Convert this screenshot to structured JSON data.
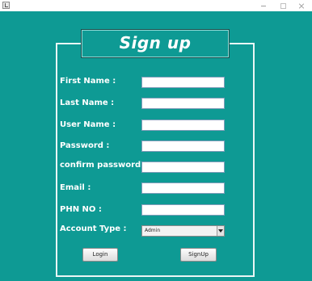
{
  "window": {
    "title": "",
    "icon": "java-app-icon",
    "controls": [
      "minimize-icon",
      "maximize-icon",
      "close-icon"
    ]
  },
  "colors": {
    "background": "#0e9a94",
    "text": "#ffffff",
    "border": "#e9f6f5"
  },
  "form": {
    "title": "Sign up",
    "fields": [
      {
        "label": "First Name :",
        "value": ""
      },
      {
        "label": "Last Name :",
        "value": ""
      },
      {
        "label": "User Name :",
        "value": ""
      },
      {
        "label": "Password :",
        "value": ""
      },
      {
        "label": "confirm password :",
        "value": ""
      },
      {
        "label": "Email :",
        "value": ""
      },
      {
        "label": "PHN NO :",
        "value": ""
      }
    ],
    "account_type": {
      "label": "Account Type :",
      "selected": "Admin"
    },
    "buttons": {
      "login": "Login",
      "signup": "SignUp"
    }
  }
}
